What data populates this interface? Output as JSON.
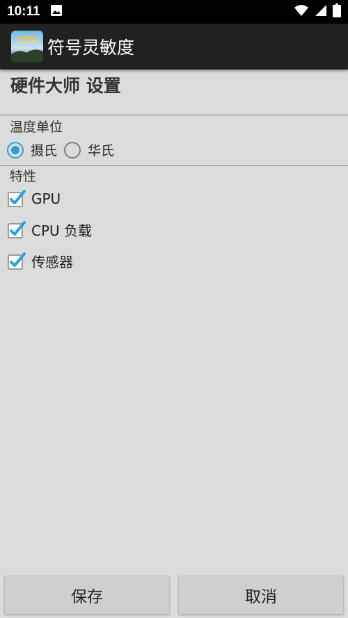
{
  "status_bar": {
    "time": "10:11",
    "icons": [
      "image-icon",
      "wifi-icon",
      "cellular-signal-icon",
      "battery-icon"
    ]
  },
  "app_bar": {
    "title": "符号灵敏度"
  },
  "page": {
    "heading": "硬件大师 设置"
  },
  "temperature": {
    "label": "温度单位",
    "options": [
      {
        "label": "摄氏",
        "checked": true
      },
      {
        "label": "华氏",
        "checked": false
      }
    ]
  },
  "features": {
    "label": "特性",
    "items": [
      {
        "label": "GPU",
        "checked": true
      },
      {
        "label": "CPU 负载",
        "checked": true
      },
      {
        "label": "传感器",
        "checked": true
      }
    ]
  },
  "buttons": {
    "save": "保存",
    "cancel": "取消"
  },
  "colors": {
    "accent": "#2b9fd6",
    "app_bar": "#212121",
    "background": "#dcdcdc"
  }
}
